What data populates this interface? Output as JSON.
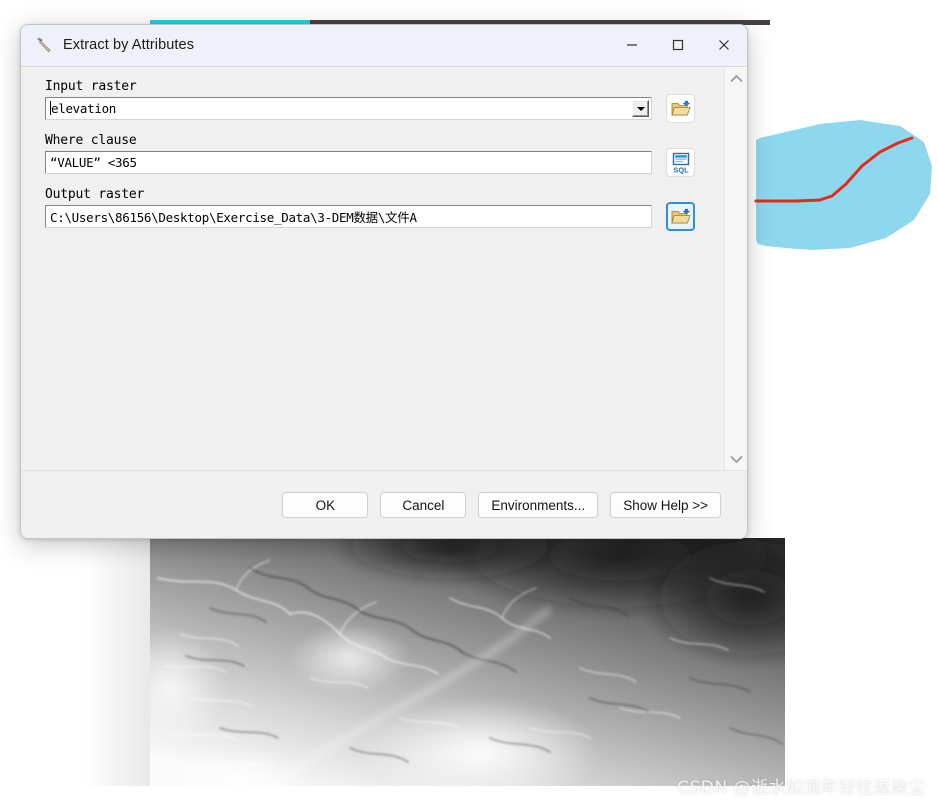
{
  "background": {
    "toolbar_cyan_color": "#22d3dd",
    "toolbar_dark_color": "#474242",
    "water_polygon_color": "#8ed8ef",
    "river_line_color": "#e8291a",
    "raster_name": "dem-hillshade-raster"
  },
  "dialog": {
    "title": "Extract by Attributes",
    "title_icon": "hammer-tool-icon",
    "window_controls": {
      "minimize": "—",
      "maximize": "□",
      "close": "✕"
    },
    "fields": [
      {
        "label": "Input raster",
        "value": "elevation",
        "type": "combobox",
        "icon": "open-folder-icon"
      },
      {
        "label": "Where clause",
        "value": "“VALUE” <365",
        "type": "text",
        "icon": "sql-builder-icon",
        "icon_caption": "SQL"
      },
      {
        "label": "Output raster",
        "value": "C:\\Users\\86156\\Desktop\\Exercise_Data\\3-DEM数据\\文件A",
        "type": "text",
        "icon": "open-folder-icon"
      }
    ],
    "scrollbar": {
      "up_arrow": "⌃",
      "down_arrow": "⌄"
    },
    "buttons": [
      {
        "label": "OK",
        "name": "ok-button"
      },
      {
        "label": "Cancel",
        "name": "cancel-button"
      },
      {
        "label": "Environments...",
        "name": "environments-button"
      },
      {
        "label": "Show Help >>",
        "name": "show-help-button"
      }
    ]
  },
  "watermark": {
    "text": "CSDN @逝水如流年轻往返染尘"
  }
}
